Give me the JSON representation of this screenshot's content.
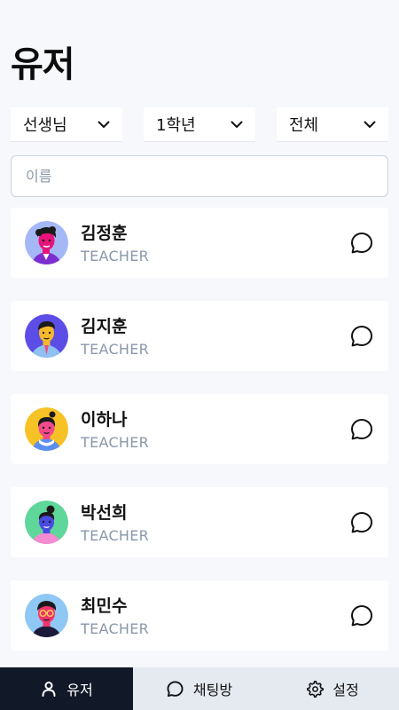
{
  "header": {
    "title": "유저"
  },
  "filters": [
    {
      "label": "선생님"
    },
    {
      "label": "1학년"
    },
    {
      "label": "전체"
    }
  ],
  "search": {
    "placeholder": "이름",
    "value": ""
  },
  "users": [
    {
      "name": "김정훈",
      "role": "TEACHER",
      "avatar_icon": "avatar-man-curly-hair-icon",
      "avatar_bg": "#a4b8f5"
    },
    {
      "name": "김지훈",
      "role": "TEACHER",
      "avatar_icon": "avatar-man-short-hair-icon",
      "avatar_bg": "#5b4de6"
    },
    {
      "name": "이하나",
      "role": "TEACHER",
      "avatar_icon": "avatar-woman-bun-icon",
      "avatar_bg": "#f7c225"
    },
    {
      "name": "박선희",
      "role": "TEACHER",
      "avatar_icon": "avatar-woman-top-bun-icon",
      "avatar_bg": "#5fd69a"
    },
    {
      "name": "최민수",
      "role": "TEACHER",
      "avatar_icon": "avatar-man-glasses-icon",
      "avatar_bg": "#8fc7f5"
    }
  ],
  "bottom_nav": [
    {
      "label": "유저",
      "icon": "user-icon",
      "active": true
    },
    {
      "label": "채팅방",
      "icon": "chat-bubble-icon",
      "active": false
    },
    {
      "label": "설정",
      "icon": "gear-icon",
      "active": false
    }
  ],
  "colors": {
    "background": "#f6f8fb",
    "card": "#ffffff",
    "role_text": "#8a97aa",
    "nav_active_bg": "#111827",
    "nav_bg": "#e5e9f0"
  }
}
